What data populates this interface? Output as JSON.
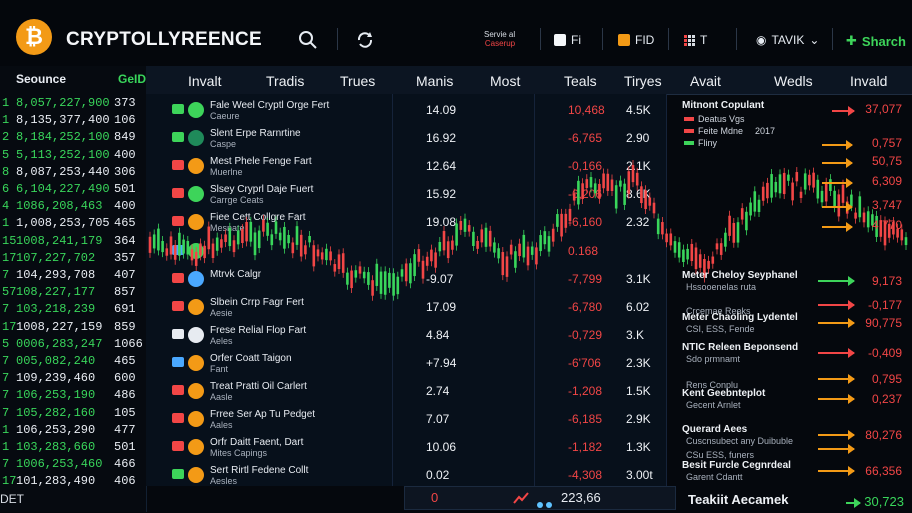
{
  "header": {
    "logo_glyph": "₿",
    "brand": "CRYPTOLLYREENCE",
    "service_line1": "Servie al",
    "service_line2": "Caserup",
    "pill1": "Fi",
    "pill2": "FID",
    "pill3": "T",
    "pill4": "TAVIK",
    "pill4_caret": "⌄",
    "search_label": "Sharch"
  },
  "left_panel": {
    "head1": "Seounce",
    "head2": "GeID",
    "rows": [
      {
        "idx": "1",
        "val": "8,057,227,900",
        "num": "373"
      },
      {
        "idx": "1",
        "val": "8,135,377,400",
        "num": "106"
      },
      {
        "idx": "2",
        "val": "8,184,252,100",
        "num": "849"
      },
      {
        "idx": "5",
        "val": "5,113,252,100",
        "num": "400"
      },
      {
        "idx": "8",
        "val": "8,087,253,440",
        "num": "306"
      },
      {
        "idx": "6",
        "val": "6,104,227,490",
        "num": "501"
      },
      {
        "idx": "4",
        "val": "1086,208,463",
        "num": "400"
      },
      {
        "idx": "1",
        "val": "1,008,253,705",
        "num": "465"
      },
      {
        "idx": "15",
        "val": "1008,241,179",
        "num": "364"
      },
      {
        "idx": "17",
        "val": "107,227,702",
        "num": "357"
      },
      {
        "idx": "7",
        "val": "104,293,708",
        "num": "407"
      },
      {
        "idx": "57",
        "val": "108,227,177",
        "num": "857"
      },
      {
        "idx": "7",
        "val": "103,218,239",
        "num": "691"
      },
      {
        "idx": "17",
        "val": "1008,227,159",
        "num": "859"
      },
      {
        "idx": "5",
        "val": "0006,283,247",
        "num": "1066"
      },
      {
        "idx": "7",
        "val": "005,082,240",
        "num": "465"
      },
      {
        "idx": "7",
        "val": "109,239,460",
        "num": "600"
      },
      {
        "idx": "7",
        "val": "106,253,190",
        "num": "486"
      },
      {
        "idx": "7",
        "val": "105,282,160",
        "num": "105"
      },
      {
        "idx": "1",
        "val": "106,253,290",
        "num": "477"
      },
      {
        "idx": "1",
        "val": "103,283,660",
        "num": "501"
      },
      {
        "idx": "7",
        "val": "1006,253,460",
        "num": "466"
      },
      {
        "idx": "17",
        "val": "101,283,490",
        "num": "406"
      }
    ],
    "footer": "DET"
  },
  "columns": [
    "Invalt",
    "Tradis",
    "Trues",
    "Manis",
    "Most",
    "Teals",
    "Tiryes",
    "Avait",
    "Wedls",
    "Invald"
  ],
  "rows": [
    {
      "name": "Fale Weel Cryptl Orge Fert",
      "sub": "Caeure",
      "c1": "14.09",
      "c2": "10,468",
      "c3": "4.5K",
      "ico": "#3dd45a",
      "ava": "#3dd45a"
    },
    {
      "name": "Slent Erpe Rarnrtine",
      "sub": "Caspe",
      "c1": "16.92",
      "c2": "-6,765",
      "c3": "2.90",
      "ico": "#3dd45a",
      "ava": "#1f8a5a"
    },
    {
      "name": "Mest Phele Fenge Fart",
      "sub": "Muerlne",
      "c1": "12.64",
      "c2": "-0,166",
      "c3": "2.1K",
      "ico": "#f24646",
      "ava": "#f39a16"
    },
    {
      "name": "Slsey Cryprl Daje Fuert",
      "sub": "Carrge Ceats",
      "c1": "15.92",
      "c2": "-6,206",
      "c3": "8.6K",
      "ico": "#f24646",
      "ava": "#3dd45a"
    },
    {
      "name": "Fiee Cett Collgre Fart",
      "sub": "Mesnate",
      "c1": "19.08",
      "c2": "-6,160",
      "c3": "2.32",
      "ico": "#f24646",
      "ava": "#f39a16"
    },
    {
      "name": "",
      "sub": "",
      "c1": "",
      "c2": "0.168",
      "c3": "",
      "ico": "#4aa8ff",
      "ava": "#3dd45a"
    },
    {
      "name": "Mtrvk Calgr",
      "sub": "",
      "c1": "-9.07",
      "c2": "-7,799",
      "c3": "3.1K",
      "ico": "#f24646",
      "ava": "#4aa8ff"
    },
    {
      "name": "Slbein Crrp Fagr Fert",
      "sub": "Aesie",
      "c1": "17.09",
      "c2": "-6,780",
      "c3": "6.02",
      "ico": "#f24646",
      "ava": "#f39a16"
    },
    {
      "name": "Frese Relial Flop Fart",
      "sub": "Aeles",
      "c1": "4.84",
      "c2": "-0,729",
      "c3": "3.K",
      "ico": "#e7ebf1",
      "ava": "#e7ebf1"
    },
    {
      "name": "Orfer Coatt Taigon",
      "sub": "Fant",
      "c1": "+7.94",
      "c2": "-6'706",
      "c3": "2.3K",
      "ico": "#4aa8ff",
      "ava": "#f39a16"
    },
    {
      "name": "Treat Pratti Oil Carlert",
      "sub": "Aasle",
      "c1": "2.74",
      "c2": "-1,208",
      "c3": "1.5K",
      "ico": "#f24646",
      "ava": "#f39a16"
    },
    {
      "name": "Frree Ser Ap Tu Pedget",
      "sub": "Aales",
      "c1": "7.07",
      "c2": "-6,185",
      "c3": "2.9K",
      "ico": "#f24646",
      "ava": "#f39a16"
    },
    {
      "name": "Orfr Daitt Faent, Dart",
      "sub": "Mites Capings",
      "c1": "10.06",
      "c2": "-1,182",
      "c3": "1.3K",
      "ico": "#f24646",
      "ava": "#f39a16"
    },
    {
      "name": "Sert Rirtl Fedene Collt",
      "sub": "Aesles",
      "c1": "0.02",
      "c2": "-4,308",
      "c3": "3.00t",
      "ico": "#3dd45a",
      "ava": "#f39a16"
    }
  ],
  "right_panel": {
    "top_title": "Mitnont Copulant",
    "top_value": "37,077",
    "legend": [
      {
        "label": "Deatus Vgs",
        "color": "#f24646"
      },
      {
        "label": "Feite Mdne",
        "color": "#f24646"
      },
      {
        "label": "Fliny",
        "color": "#3dd45a"
      }
    ],
    "legend_extra": "2017",
    "values_top": [
      "0,757",
      "50,75",
      "6,309",
      "3,747",
      "4,770"
    ],
    "items": [
      {
        "t": "Meter Cheloy Seyphanel",
        "s": "Hssooenelas ruta",
        "v": "9,173",
        "vc": "#f24646",
        "ac": "#3dd45a"
      },
      {
        "t": "",
        "s": "Crcemae Reeks",
        "v": "-0,177",
        "vc": "#f24646",
        "ac": "#f24646"
      },
      {
        "t": "Meter Chaoling Lydentel",
        "s": "CSI, ESS, Fende",
        "v": "90,775",
        "vc": "#f24646",
        "ac": "#f39a16"
      },
      {
        "t": "NTIC Releen Beponsend",
        "s": "Sdo prmnamt",
        "v": "-0,409",
        "vc": "#f24646",
        "ac": "#f24646"
      },
      {
        "t": "",
        "s": "Rens Conplu",
        "v": "0,795",
        "vc": "#f24646",
        "ac": "#f39a16"
      },
      {
        "t": "Kent Geebnteplot",
        "s": "Gecent Arnlet",
        "v": "0,237",
        "vc": "#f24646",
        "ac": "#f39a16"
      },
      {
        "t": "Querard Aees",
        "s": "Cuscnsubect any Duibuble",
        "v": "80,276",
        "vc": "#f24646",
        "ac": "#f39a16"
      },
      {
        "t": "",
        "s": "CSu ESS, funers",
        "v": "",
        "vc": "#f24646",
        "ac": "#f39a16"
      },
      {
        "t": "Besit Furcle Cegnrdeal",
        "s": "Garent Cdantt",
        "v": "66,356",
        "vc": "#f24646",
        "ac": "#f39a16"
      }
    ],
    "bottom_title": "Teakiit Aecamek",
    "bottom_value": "30,723"
  },
  "bottom_bar": {
    "zero": "0",
    "value": "223,66"
  }
}
